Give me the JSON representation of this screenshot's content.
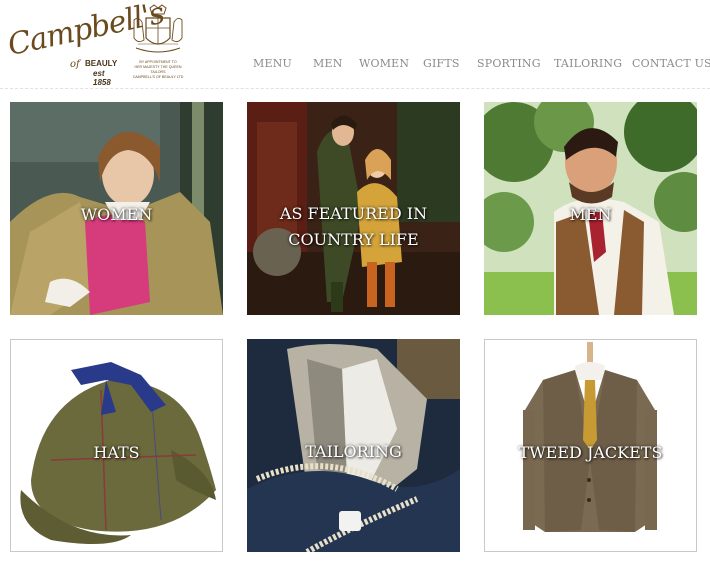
{
  "logo": {
    "brand": "Campbell's",
    "of": "of",
    "beauly": "BEAULY",
    "est": "est 1858",
    "crest_text": [
      "BY APPOINTMENT TO",
      "HER MAJESTY THE QUEEN",
      "TAILORS",
      "CAMPBELL'S OF BEAULY LTD"
    ]
  },
  "nav": [
    "MENU",
    "MEN",
    "WOMEN",
    "GIFTS",
    "SPORTING",
    "TAILORING",
    "CONTACT US"
  ],
  "tiles": [
    {
      "label": "WOMEN"
    },
    {
      "label_line1": "AS FEATURED IN",
      "label_line2": "COUNTRY LIFE"
    },
    {
      "label": "MEN"
    },
    {
      "label": "HATS"
    },
    {
      "label": "TAILORING"
    },
    {
      "label": "TWEED JACKETS"
    }
  ],
  "colors": {
    "brand_brown": "#6b4a1e",
    "nav_grey": "#8b8b8b"
  }
}
